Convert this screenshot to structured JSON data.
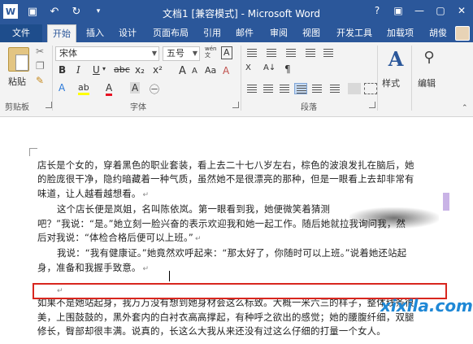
{
  "window": {
    "title": "文档1 [兼容模式] - Microsoft Word",
    "controls": [
      "?",
      "▣",
      "—",
      "▢",
      "✕"
    ]
  },
  "qat": {
    "icons": [
      "word-icon",
      "save-icon",
      "undo-icon",
      "redo-icon",
      "customize-icon"
    ],
    "undo": "↶",
    "redo": "↻"
  },
  "tabs": {
    "file": "文件",
    "items": [
      "开始",
      "插入",
      "设计",
      "页面布局",
      "引用",
      "邮件",
      "审阅",
      "视图",
      "开发工具",
      "加载项"
    ],
    "active": "开始",
    "user": "胡俊"
  },
  "ribbon": {
    "clipboard": {
      "paste": "粘贴",
      "group": "剪贴板"
    },
    "font": {
      "name": "宋体",
      "size": "五号",
      "wen": "wén\n文",
      "A_box": "A",
      "bold": "B",
      "italic": "I",
      "underline": "U",
      "strike": "abc",
      "sub": "x₂",
      "sup": "x²",
      "grow": "A",
      "shrink": "A",
      "case": "Aa",
      "clear": "A",
      "highlight": "ab",
      "color": "A",
      "shade": "A",
      "circled": "㊀",
      "group": "字体"
    },
    "paragraph": {
      "group": "段落",
      "sort": "A↓",
      "pilcrow": "¶"
    },
    "styles": {
      "icon": "A",
      "label": "样式"
    },
    "editing": {
      "label": "编辑"
    }
  },
  "document": {
    "lines": [
      "店长是个女的，穿着黑色的职业套装，看上去二十七八岁左右，棕色的波浪发扎在脑后，她",
      "的脸庞很干净，隐约暗藏着一种气质，虽然她不是很漂亮的那种，但是一眼看上去却非常有",
      "味道，让人越看越想看。",
      "这个店长便是岚姐，名叫陈依岚。第一眼看到我，她便微笑着猜测",
      "吧？”我说：“是。”她立刻一脸兴奋的表示欢迎我和她一起工作。随后她就拉我询问我，然",
      "后对我说：“体检合格后便可以上班。”",
      "我说：“我有健康证。”她竟然欢呼起来：“那太好了，你随时可以上班。”说着她还站起",
      "身，准备和我握手致意。",
      "如果不是她站起身，我万万没有想到她身材会这么标致。大概一米六三的样子，整体线条很",
      "美，上围鼓鼓的，黑外套内的白衬衣高高撑起，有种呼之欲出的感觉；她的腰腹纤细，双腿",
      "修长，臀部却很丰满。说真的，长这么大我从来还没有过这么仔细的打量一个女人。"
    ],
    "para_mark": "↵"
  },
  "watermark": "xixila.com"
}
